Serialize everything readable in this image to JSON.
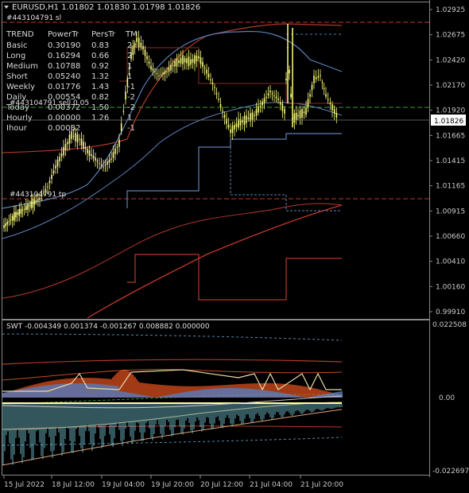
{
  "header": {
    "symbol_line": "EURUSD,H1  1.01802 1.01830 1.01798 1.01826",
    "sl_label": "#443104791 sl",
    "sell_label": "#443104791 sell 0.05",
    "tp_label": "#443104791 tp"
  },
  "trend_table": {
    "columns": [
      "TREND",
      "PowerTr",
      "PersTr",
      "TM"
    ],
    "rows": [
      [
        "Basic",
        "0.30190",
        "0.83",
        "2"
      ],
      [
        "Long",
        "0.16294",
        "0.66",
        "2"
      ],
      [
        "Medium",
        "0.10788",
        "0.92",
        "1"
      ],
      [
        "Short",
        "0.05240",
        "1.32",
        "1"
      ],
      [
        "Weekly",
        "0.01776",
        "1.43",
        "-1"
      ],
      [
        "Daily",
        "0.00554",
        "0.82",
        "-2"
      ],
      [
        "Today",
        "0.00372",
        "1.50",
        "-2"
      ],
      [
        "Hourly",
        "0.00000",
        "1.26",
        "1"
      ],
      [
        "Ihour",
        "0.00082",
        "",
        "-1"
      ]
    ]
  },
  "price_axis": [
    "1.02925",
    "1.02675",
    "1.02420",
    "1.02170",
    "1.01920",
    "1.01665",
    "1.01415",
    "1.01165",
    "1.00915",
    "1.00660",
    "1.00410",
    "1.00160",
    "0.99910"
  ],
  "current_price": "1.01826",
  "indicator": {
    "label": "SWT -0.004349 0.001374 -0.001267 0.008882 0.000000",
    "axis": [
      "0.022508",
      "0.00",
      "-0.022697"
    ]
  },
  "time_axis": [
    "15 Jul 2022",
    "18 Jul 12:00",
    "19 Jul 04:00",
    "19 Jul 20:00",
    "20 Jul 12:00",
    "21 Jul 04:00",
    "21 Jul 20:00"
  ],
  "colors": {
    "background": "#000000",
    "candle": "#ffff80",
    "price_box": "#ffffff",
    "red_line": "#c0392b",
    "blue_line": "#6b8fc9",
    "histogram_orange": "#e8531f",
    "histogram_blue": "#6a8fd8",
    "histogram_cyan": "#7fd8e8"
  }
}
